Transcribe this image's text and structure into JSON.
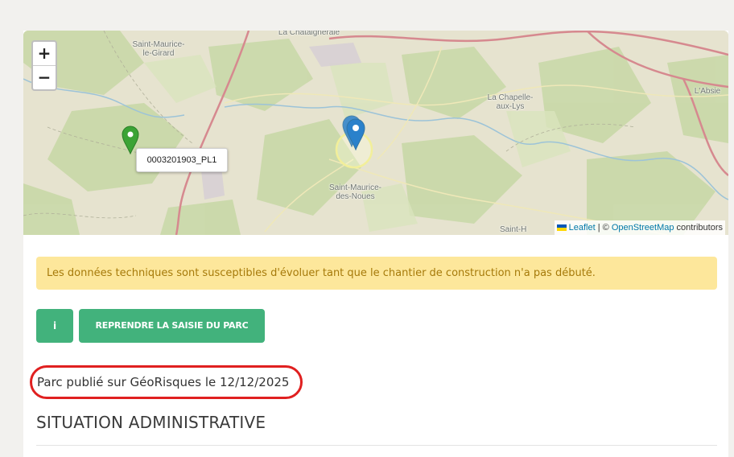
{
  "map": {
    "zoom_in": "+",
    "zoom_out": "−",
    "places": {
      "saint_maurice_le_girard": "Saint-Maurice-\nle-Girard",
      "la_chataigneraie": "La Châtaigneraie",
      "la_chapelle_aux_lys": "La Chapelle-\naux-Lys",
      "labsie": "L'Absie",
      "saint_maurice_des_noues": "Saint-Maurice-\ndes-Noues",
      "saint_h": "Saint-H"
    },
    "marker_tooltip": "0003201903_PL1",
    "attribution": {
      "leaflet": "Leaflet",
      "separator": " | © ",
      "osm": "OpenStreetMap",
      "suffix": " contributors"
    },
    "colors": {
      "land": "#e6e3cf",
      "forest": "#c9d8a8",
      "major_road": "#d6898f",
      "river": "#9cc3d8",
      "green_marker": "#3ba335",
      "blue_marker": "#2a81cb"
    }
  },
  "alert": {
    "text": "Les données techniques sont susceptibles d'évoluer tant que le chantier de construction n'a pas débuté."
  },
  "buttons": {
    "info_label": "i",
    "resume_label": "REPRENDRE LA SAISIE DU PARC"
  },
  "published_text": "Parc publié sur GéoRisques le 12/12/2025",
  "section_title": "SITUATION ADMINISTRATIVE"
}
